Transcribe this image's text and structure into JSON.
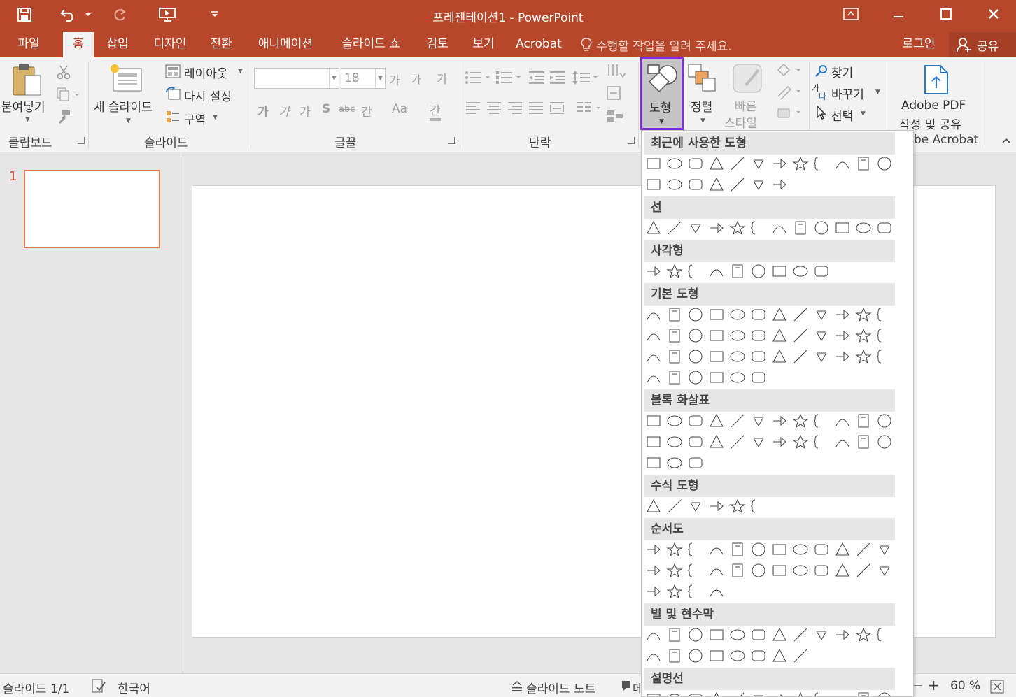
{
  "window": {
    "title": "프레젠테이션1 - PowerPoint"
  },
  "quick_access": {
    "icons": [
      "save-icon",
      "undo-icon",
      "redo-icon",
      "start-from-beginning-icon",
      "customize-qat-icon"
    ]
  },
  "tabs": [
    "파일",
    "홈",
    "삽입",
    "디자인",
    "전환",
    "애니메이션",
    "슬라이드 쇼",
    "검토",
    "보기",
    "Acrobat"
  ],
  "active_tab": "홈",
  "tell_me": "수행할 작업을 알려 주세요.",
  "account": {
    "signin": "로그인",
    "share": "공유"
  },
  "ribbon": {
    "clipboard": {
      "paste": "붙여넣기",
      "label": "클립보드"
    },
    "slides": {
      "new_slide_line1": "새 슬라이드",
      "layout": "레이아웃",
      "reset": "다시 설정",
      "section": "구역",
      "label": "슬라이드"
    },
    "font": {
      "font_name": "",
      "font_size": "18",
      "grow": "가",
      "shrink": "가",
      "clear_format": "가",
      "bold": "가",
      "italic": "가",
      "underline": "가",
      "shadow": "S",
      "strike": "abc",
      "spacing": "간",
      "case": "Aa",
      "color": "간",
      "label": "글꼴"
    },
    "paragraph": {
      "label": "단락"
    },
    "drawing": {
      "shapes": "도형",
      "arrange": "정렬",
      "quick_styles_line1": "빠른",
      "quick_styles_line2": "스타일"
    },
    "editing": {
      "find": "찾기",
      "replace": "바꾸기",
      "select": "선택"
    },
    "acrobat": {
      "line1": "Adobe PDF",
      "line2": "작성 및 공유",
      "label": "be Acrobat"
    }
  },
  "thumbnail": {
    "number": "1"
  },
  "shapes_gallery": {
    "sections": [
      {
        "title": "최근에 사용한 도형",
        "count": 19
      },
      {
        "title": "선",
        "count": 12
      },
      {
        "title": "사각형",
        "count": 9
      },
      {
        "title": "기본 도형",
        "count": 42
      },
      {
        "title": "블록 화살표",
        "count": 27
      },
      {
        "title": "수식 도형",
        "count": 6
      },
      {
        "title": "순서도",
        "count": 28
      },
      {
        "title": "별 및 현수막",
        "count": 20
      },
      {
        "title": "설명선",
        "count": 12
      }
    ]
  },
  "status": {
    "slide": "슬라이드 1/1",
    "language": "한국어",
    "notes": "슬라이드 노트",
    "comments_partial": "메",
    "zoom": "60 %"
  }
}
